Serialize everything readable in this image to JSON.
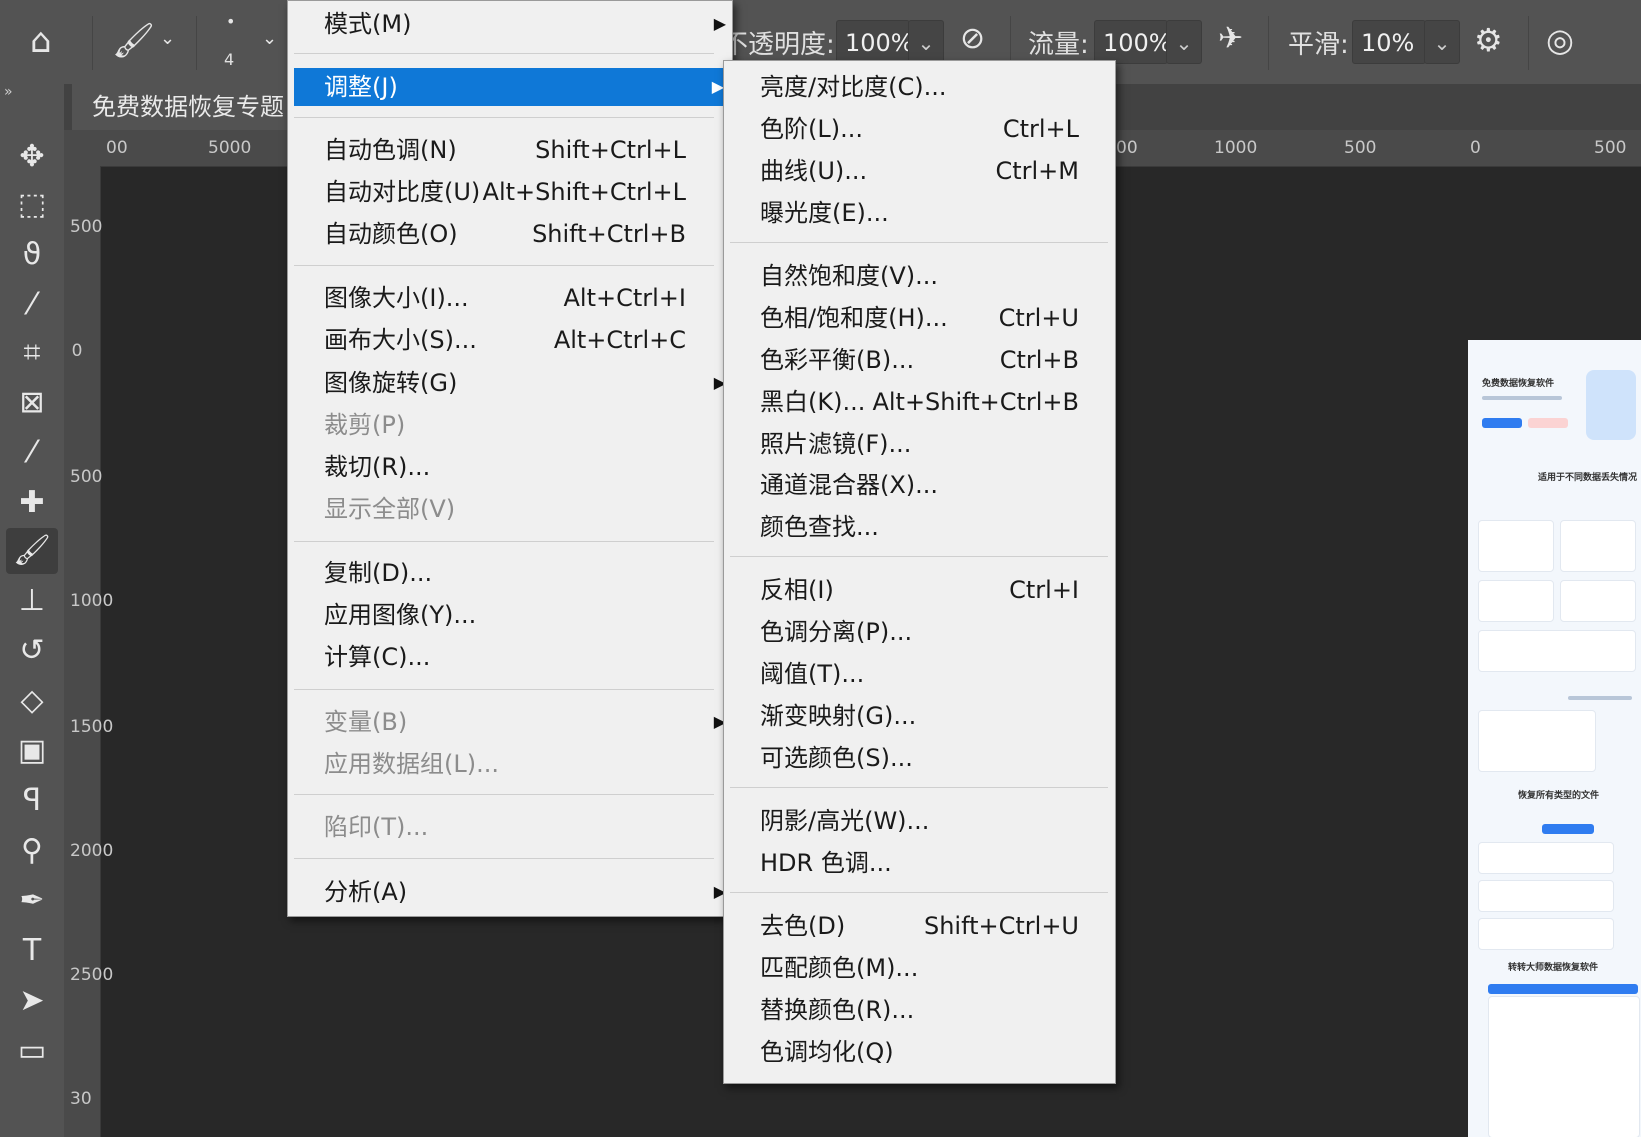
{
  "options_bar": {
    "brush_size": "4",
    "opacity_label": "不透明度:",
    "opacity_value": "100%",
    "flow_label": "流量:",
    "flow_value": "100%",
    "smoothing_label": "平滑:",
    "smoothing_value": "10%"
  },
  "document": {
    "tab_title": "免费数据恢复专题"
  },
  "ruler": {
    "h_ticks": [
      "00",
      "5000",
      "00",
      "1000",
      "500",
      "0",
      "500"
    ],
    "v_ticks": [
      "500",
      "0",
      "500",
      "1000",
      "1500",
      "2000",
      "2500",
      "30"
    ]
  },
  "image_menu": {
    "items": [
      {
        "label": "模式(M)",
        "shortcut": "",
        "submenu": true,
        "disabled": false
      },
      {
        "label": "调整(J)",
        "shortcut": "",
        "submenu": true,
        "disabled": false,
        "highlight": true
      },
      {
        "label": "自动色调(N)",
        "shortcut": "Shift+Ctrl+L",
        "disabled": false
      },
      {
        "label": "自动对比度(U)",
        "shortcut": "Alt+Shift+Ctrl+L",
        "disabled": false
      },
      {
        "label": "自动颜色(O)",
        "shortcut": "Shift+Ctrl+B",
        "disabled": false
      },
      {
        "label": "图像大小(I)...",
        "shortcut": "Alt+Ctrl+I",
        "disabled": false
      },
      {
        "label": "画布大小(S)...",
        "shortcut": "Alt+Ctrl+C",
        "disabled": false
      },
      {
        "label": "图像旋转(G)",
        "shortcut": "",
        "submenu": true,
        "disabled": false
      },
      {
        "label": "裁剪(P)",
        "shortcut": "",
        "disabled": true
      },
      {
        "label": "裁切(R)...",
        "shortcut": "",
        "disabled": false
      },
      {
        "label": "显示全部(V)",
        "shortcut": "",
        "disabled": true
      },
      {
        "label": "复制(D)...",
        "shortcut": "",
        "disabled": false
      },
      {
        "label": "应用图像(Y)...",
        "shortcut": "",
        "disabled": false
      },
      {
        "label": "计算(C)...",
        "shortcut": "",
        "disabled": false
      },
      {
        "label": "变量(B)",
        "shortcut": "",
        "submenu": true,
        "disabled": true
      },
      {
        "label": "应用数据组(L)...",
        "shortcut": "",
        "disabled": true
      },
      {
        "label": "陷印(T)...",
        "shortcut": "",
        "disabled": true
      },
      {
        "label": "分析(A)",
        "shortcut": "",
        "submenu": true,
        "disabled": false
      }
    ]
  },
  "adjust_menu": {
    "items": [
      {
        "label": "亮度/对比度(C)...",
        "shortcut": ""
      },
      {
        "label": "色阶(L)...",
        "shortcut": "Ctrl+L"
      },
      {
        "label": "曲线(U)...",
        "shortcut": "Ctrl+M"
      },
      {
        "label": "曝光度(E)...",
        "shortcut": ""
      },
      {
        "label": "自然饱和度(V)...",
        "shortcut": ""
      },
      {
        "label": "色相/饱和度(H)...",
        "shortcut": "Ctrl+U"
      },
      {
        "label": "色彩平衡(B)...",
        "shortcut": "Ctrl+B"
      },
      {
        "label": "黑白(K)...",
        "shortcut": "Alt+Shift+Ctrl+B"
      },
      {
        "label": "照片滤镜(F)...",
        "shortcut": ""
      },
      {
        "label": "通道混合器(X)...",
        "shortcut": ""
      },
      {
        "label": "颜色查找...",
        "shortcut": ""
      },
      {
        "label": "反相(I)",
        "shortcut": "Ctrl+I"
      },
      {
        "label": "色调分离(P)...",
        "shortcut": ""
      },
      {
        "label": "阈值(T)...",
        "shortcut": ""
      },
      {
        "label": "渐变映射(G)...",
        "shortcut": ""
      },
      {
        "label": "可选颜色(S)...",
        "shortcut": ""
      },
      {
        "label": "阴影/高光(W)...",
        "shortcut": ""
      },
      {
        "label": "HDR 色调...",
        "shortcut": ""
      },
      {
        "label": "去色(D)",
        "shortcut": "Shift+Ctrl+U"
      },
      {
        "label": "匹配颜色(M)...",
        "shortcut": ""
      },
      {
        "label": "替换颜色(R)...",
        "shortcut": ""
      },
      {
        "label": "色调均化(Q)",
        "shortcut": ""
      }
    ]
  },
  "preview": {
    "heading": "免费数据恢复软件",
    "section_1": "适用于不同数据丢失情况",
    "section_2": "恢复所有类型的文件",
    "section_3": "转转大师数据恢复软件"
  },
  "colors": {
    "highlight": "#0f78d7",
    "menu_bg": "#f0f0f0",
    "panel_bg": "#535353",
    "canvas_bg": "#282828"
  }
}
